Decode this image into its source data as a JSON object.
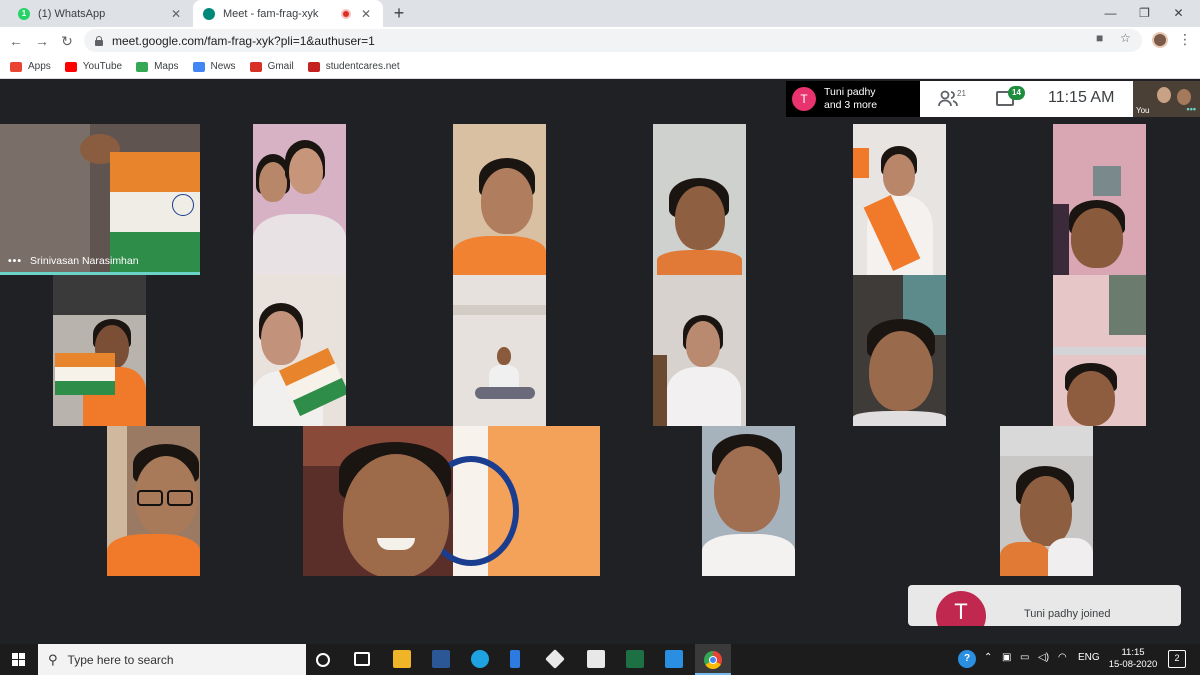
{
  "browser": {
    "tabs": [
      {
        "title": "(1) WhatsApp",
        "favicon": "whatsapp-icon",
        "badge": "1",
        "color": "#25d366"
      },
      {
        "title": "Meet - fam-frag-xyk",
        "favicon": "meet-icon",
        "color": "#00897b",
        "recording": true
      }
    ],
    "new_tab": "+",
    "url": "meet.google.com/fam-frag-xyk?pli=1&authuser=1",
    "window_controls": {
      "minimize": "—",
      "restore": "❐",
      "close": "✕"
    }
  },
  "bookmarks": [
    {
      "label": "Apps",
      "icon": "apps-grid-icon",
      "color": "#ea4335"
    },
    {
      "label": "YouTube",
      "icon": "youtube-icon",
      "color": "#ff0000"
    },
    {
      "label": "Maps",
      "icon": "maps-icon",
      "color": "#34a853"
    },
    {
      "label": "News",
      "icon": "news-icon",
      "color": "#4285f4"
    },
    {
      "label": "Gmail",
      "icon": "gmail-icon",
      "color": "#d93025"
    },
    {
      "label": "studentcares.net",
      "icon": "studentcares-icon",
      "color": "#c5221f"
    }
  ],
  "meet": {
    "presenter": {
      "initial": "T",
      "line1": "Tuni padhy",
      "line2": "and 3 more"
    },
    "participants_count": "21",
    "chat_count": "14",
    "time": "11:15 AM",
    "self_label": "You",
    "speaking_name": "Srinivasan Narasimhan",
    "notification": {
      "initial": "T",
      "text": "Tuni padhy joined"
    }
  },
  "taskbar": {
    "search_placeholder": "Type here to search",
    "language": "ENG",
    "time": "11:15",
    "date": "15-08-2020",
    "notifications": "2"
  }
}
